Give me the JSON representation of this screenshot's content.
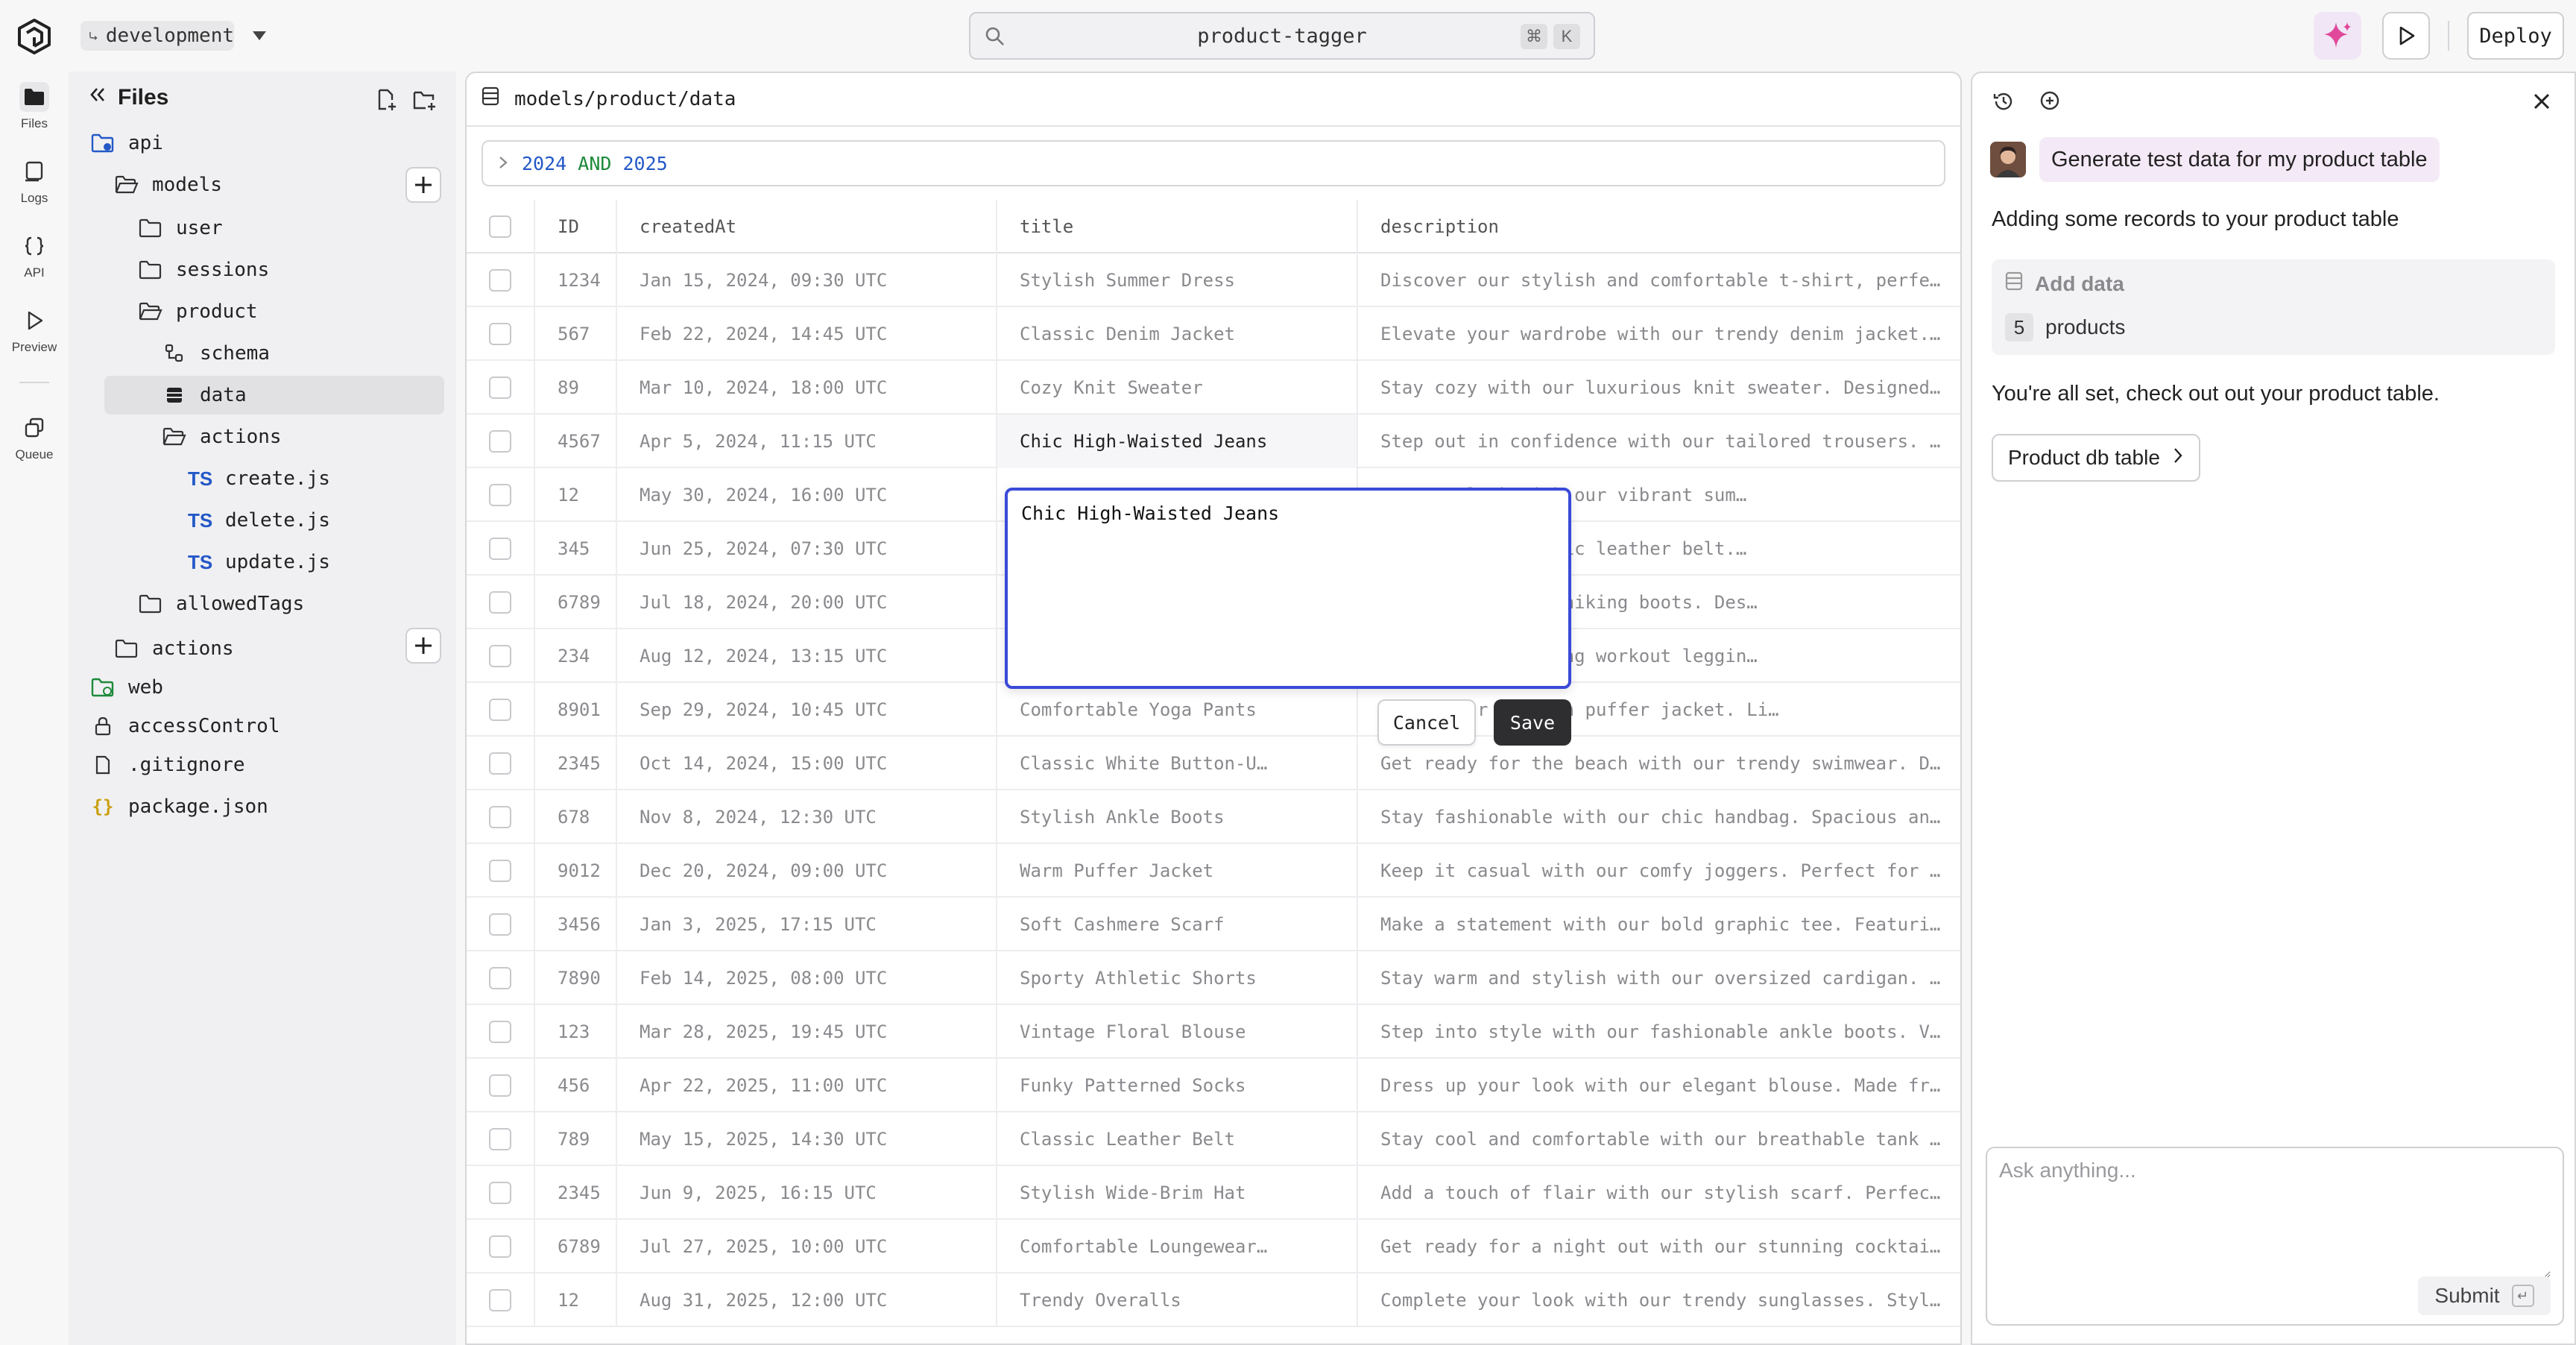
{
  "topbar": {
    "branch": "development",
    "search_label": "product-tagger",
    "shortcut_mod": "⌘",
    "shortcut_key": "K",
    "deploy_label": "Deploy"
  },
  "rail": {
    "files": "Files",
    "logs": "Logs",
    "api": "API",
    "preview": "Preview",
    "queue": "Queue"
  },
  "files_panel": {
    "title": "Files",
    "tree": {
      "api": "api",
      "models": "models",
      "user": "user",
      "sessions": "sessions",
      "product": "product",
      "schema": "schema",
      "data": "data",
      "actions_inner": "actions",
      "create": "create.js",
      "delete": "delete.js",
      "update": "update.js",
      "allowed_tags": "allowedTags",
      "actions_outer": "actions",
      "web": "web",
      "access_control": "accessControl",
      "gitignore": ".gitignore",
      "package_json": "package.json",
      "ts_badge": "TS"
    }
  },
  "main": {
    "path": "models/product/data",
    "filter": {
      "a": "2024",
      "op": "AND",
      "b": "2025"
    },
    "columns": {
      "id": "ID",
      "created": "createdAt",
      "title": "title",
      "description": "description"
    },
    "rows": [
      {
        "id": "1234",
        "created": "Jan 15, 2024, 09:30 UTC",
        "title": "Stylish Summer Dress",
        "description": "Discover our stylish and comfortable t-shirt, perfec…"
      },
      {
        "id": "567",
        "created": "Feb 22, 2024, 14:45 UTC",
        "title": "Classic Denim Jacket",
        "description": "Elevate your wardrobe with our trendy denim jacket.…"
      },
      {
        "id": "89",
        "created": "Mar 10, 2024, 18:00 UTC",
        "title": "Cozy Knit Sweater",
        "description": "Stay cozy with our luxurious knit sweater. Designed…"
      },
      {
        "id": "4567",
        "created": "Apr 5, 2024, 11:15 UTC",
        "title": "Chic High-Waisted Jeans",
        "description": "Step out in confidence with our tailored trousers. T…"
      },
      {
        "id": "12",
        "created": "May 30, 2024, 16:00 UTC",
        "title": "",
        "description": "to your look with our vibrant sum…"
      },
      {
        "id": "345",
        "created": "Jun 25, 2024, 07:30 UTC",
        "title": "",
        "description": "it with our classic leather belt.…"
      },
      {
        "id": "6789",
        "created": "Jul 18, 2024, 20:00 UTC",
        "title": "",
        "description": "rs in our rugged hiking boots. Des…"
      },
      {
        "id": "234",
        "created": "Aug 12, 2024, 13:15 UTC",
        "title": "",
        "description": "ur moisture-wicking workout leggin…"
      },
      {
        "id": "8901",
        "created": "Sep 29, 2024, 10:45 UTC",
        "title": "Comfortable Yoga Pants",
        "description": "h with our stylish puffer jacket. Li…"
      },
      {
        "id": "2345",
        "created": "Oct 14, 2024, 15:00 UTC",
        "title": "Classic White Button-U…",
        "description": "Get ready for the beach with our trendy swimwear. De…"
      },
      {
        "id": "678",
        "created": "Nov 8, 2024, 12:30 UTC",
        "title": "Stylish Ankle Boots",
        "description": "Stay fashionable with our chic handbag. Spacious and…"
      },
      {
        "id": "9012",
        "created": "Dec 20, 2024, 09:00 UTC",
        "title": "Warm Puffer Jacket",
        "description": "Keep it casual with our comfy joggers. Perfect for l…"
      },
      {
        "id": "3456",
        "created": "Jan 3, 2025, 17:15 UTC",
        "title": "Soft Cashmere Scarf",
        "description": "Make a statement with our bold graphic tee. Featurin…"
      },
      {
        "id": "7890",
        "created": "Feb 14, 2025, 08:00 UTC",
        "title": "Sporty Athletic Shorts",
        "description": "Stay warm and stylish with our oversized cardigan. P…"
      },
      {
        "id": "123",
        "created": "Mar 28, 2025, 19:45 UTC",
        "title": "Vintage Floral Blouse",
        "description": "Step into style with our fashionable ankle boots. Ve…"
      },
      {
        "id": "456",
        "created": "Apr 22, 2025, 11:00 UTC",
        "title": "Funky Patterned Socks",
        "description": "Dress up your look with our elegant blouse. Made fro…"
      },
      {
        "id": "789",
        "created": "May 15, 2025, 14:30 UTC",
        "title": "Classic Leather Belt",
        "description": "Stay cool and comfortable with our breathable tank t…"
      },
      {
        "id": "2345",
        "created": "Jun 9, 2025, 16:15 UTC",
        "title": "Stylish Wide-Brim Hat",
        "description": "Add a touch of flair with our stylish scarf. Perfect…"
      },
      {
        "id": "6789",
        "created": "Jul 27, 2025, 10:00 UTC",
        "title": "Comfortable Loungewear…",
        "description": "Get ready for a night out with our stunning cocktail…"
      },
      {
        "id": "12",
        "created": "Aug 31, 2025, 12:00 UTC",
        "title": "Trendy Overalls",
        "description": "Complete your look with our trendy sunglasses. Styli…"
      }
    ],
    "editor": {
      "value": "Chic High-Waisted Jeans",
      "cancel_label": "Cancel",
      "save_label": "Save"
    }
  },
  "chat": {
    "user_message": "Generate test data for my product table",
    "reply_intro": "Adding some records to your product table",
    "tool": {
      "title": "Add data",
      "count": "5",
      "unit": "products"
    },
    "reply_done": "You're all set, check out out your product table.",
    "link_label": "Product db table",
    "input_placeholder": "Ask anything...",
    "submit_label": "Submit"
  },
  "colors": {
    "accent_blue": "#3a4ad8",
    "ts_blue": "#2458c7",
    "save_dark": "#2e2e30",
    "sparkle_pink": "#e0489a",
    "user_bubble": "#f4e9f6"
  }
}
